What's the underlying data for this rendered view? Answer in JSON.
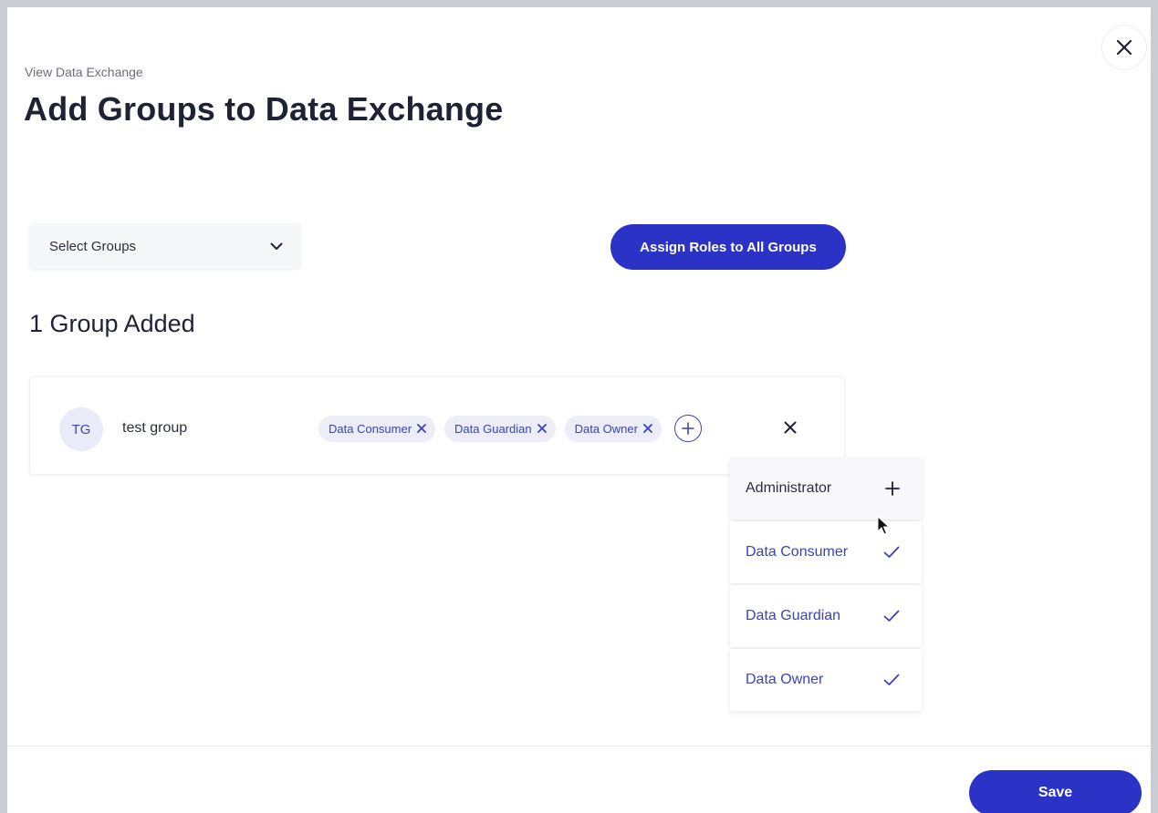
{
  "breadcrumb": "View Data Exchange",
  "title": "Add Groups to Data Exchange",
  "select_groups": {
    "label": "Select Groups",
    "icon": "chevron-down-icon"
  },
  "assign_button": "Assign Roles to All Groups",
  "groups_count": "1 Group Added",
  "group": {
    "initials": "TG",
    "name": "test group",
    "roles": [
      "Data Consumer",
      "Data Guardian",
      "Data Owner"
    ]
  },
  "role_menu": [
    {
      "label": "Administrator",
      "selected": false
    },
    {
      "label": "Data Consumer",
      "selected": true
    },
    {
      "label": "Data Guardian",
      "selected": true
    },
    {
      "label": "Data Owner",
      "selected": true
    }
  ],
  "save_button": "Save",
  "colors": {
    "accent": "#2b33c7",
    "chip_bg": "#ecedf7",
    "chip_text": "#3a44b8"
  }
}
